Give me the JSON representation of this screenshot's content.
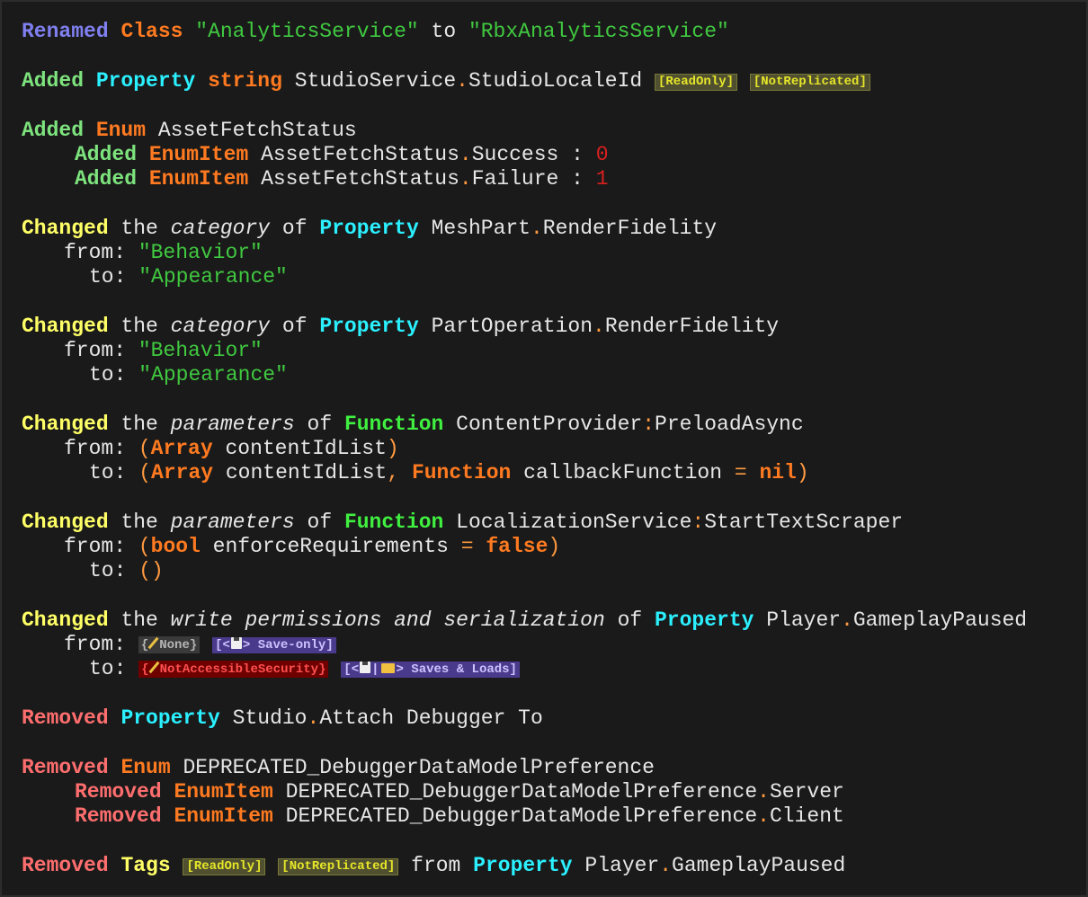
{
  "lines": {
    "l1": {
      "action": "Renamed",
      "kind": "Class",
      "name": "\"AnalyticsService\"",
      "to": "to",
      "newname": "\"RbxAnalyticsService\""
    },
    "l2": {
      "action": "Added",
      "kind": "Property",
      "type": "string",
      "owner": "StudioService",
      "dot": ".",
      "member": "StudioLocaleId",
      "tag1": "[ReadOnly]",
      "tag2": "[NotReplicated]"
    },
    "l3": {
      "action": "Added",
      "kind": "Enum",
      "name": "AssetFetchStatus"
    },
    "l4": {
      "action": "Added",
      "kind": "EnumItem",
      "owner": "AssetFetchStatus",
      "dot": ".",
      "member": "Success",
      "sep": " : ",
      "value": "0"
    },
    "l5": {
      "action": "Added",
      "kind": "EnumItem",
      "owner": "AssetFetchStatus",
      "dot": ".",
      "member": "Failure",
      "sep": " : ",
      "value": "1"
    },
    "l6": {
      "action": "Changed",
      "the": "the",
      "what": "category",
      "of": "of",
      "kind": "Property",
      "owner": "MeshPart",
      "dot": ".",
      "member": "RenderFidelity"
    },
    "l7": {
      "label": "from:",
      "value": "\"Behavior\""
    },
    "l8": {
      "label": "to:",
      "value": "\"Appearance\""
    },
    "l9": {
      "action": "Changed",
      "the": "the",
      "what": "category",
      "of": "of",
      "kind": "Property",
      "owner": "PartOperation",
      "dot": ".",
      "member": "RenderFidelity"
    },
    "l10": {
      "label": "from:",
      "value": "\"Behavior\""
    },
    "l11": {
      "label": "to:",
      "value": "\"Appearance\""
    },
    "l12": {
      "action": "Changed",
      "the": "the",
      "what": "parameters",
      "of": "of",
      "kind": "Function",
      "owner": "ContentProvider",
      "colon": ":",
      "member": "PreloadAsync"
    },
    "l13": {
      "label": "from:",
      "open": "(",
      "type1": "Array",
      "name1": "contentIdList",
      "close": ")"
    },
    "l14": {
      "label": "to:",
      "open": "(",
      "type1": "Array",
      "name1": "contentIdList",
      "comma": ",",
      "type2": "Function",
      "name2": "callbackFunction",
      "eq": "=",
      "def": "nil",
      "close": ")"
    },
    "l15": {
      "action": "Changed",
      "the": "the",
      "what": "parameters",
      "of": "of",
      "kind": "Function",
      "owner": "LocalizationService",
      "colon": ":",
      "member": "StartTextScraper"
    },
    "l16": {
      "label": "from:",
      "open": "(",
      "type1": "bool",
      "name1": "enforceRequirements",
      "eq": "=",
      "def": "false",
      "close": ")"
    },
    "l17": {
      "label": "to:",
      "value": "()"
    },
    "l18": {
      "action": "Changed",
      "the": "the",
      "what": "write permissions and serialization",
      "of": "of",
      "kind": "Property",
      "owner": "Player",
      "dot": ".",
      "member": "GameplayPaused"
    },
    "l19": {
      "label": "from:",
      "sec_open": "{",
      "sec": "None",
      "sec_close": "}",
      "ser_open": "[<",
      "ser_mid": ">",
      "ser": "Save-only",
      "ser_close": "]"
    },
    "l20": {
      "label": "to:",
      "sec_open": "{",
      "sec": "NotAccessibleSecurity",
      "sec_close": "}",
      "ser_open": "[<",
      "ser_pipe": "|",
      "ser_mid": ">",
      "ser": "Saves & Loads",
      "ser_close": "]"
    },
    "l21": {
      "action": "Removed",
      "kind": "Property",
      "owner": "Studio",
      "dot": ".",
      "member": "Attach Debugger To"
    },
    "l22": {
      "action": "Removed",
      "kind": "Enum",
      "name": "DEPRECATED_DebuggerDataModelPreference"
    },
    "l23": {
      "action": "Removed",
      "kind": "EnumItem",
      "owner": "DEPRECATED_DebuggerDataModelPreference",
      "dot": ".",
      "member": "Server"
    },
    "l24": {
      "action": "Removed",
      "kind": "EnumItem",
      "owner": "DEPRECATED_DebuggerDataModelPreference",
      "dot": ".",
      "member": "Client"
    },
    "l25": {
      "action": "Removed",
      "kind": "Tags",
      "tag1": "[ReadOnly]",
      "tag2": "[NotReplicated]",
      "from": "from",
      "kind2": "Property",
      "owner": "Player",
      "dot": ".",
      "member": "GameplayPaused"
    }
  },
  "icons": {
    "edit": "pencil-icon",
    "save": "floppy-disk-icon",
    "load": "folder-icon"
  },
  "colors": {
    "background": "#1a1a1a",
    "renamed": "#7f7ff0",
    "added": "#7de37d",
    "changed": "#ffff66",
    "removed": "#ff6e6e",
    "class": "#ff7a20",
    "property": "#2af0ff",
    "function": "#40f040",
    "string": "#40c840",
    "number": "#d82020"
  }
}
